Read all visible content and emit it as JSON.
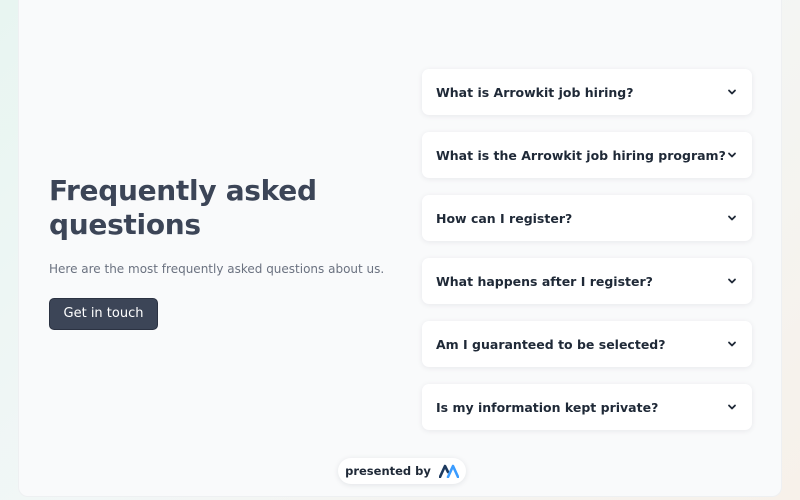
{
  "hero": {
    "title": "Frequently asked questions",
    "subtitle": "Here are the most frequently asked questions about us.",
    "cta_label": "Get in touch"
  },
  "faq": [
    {
      "question": "What is Arrowkit job hiring?"
    },
    {
      "question": "What is the Arrowkit job hiring program?"
    },
    {
      "question": "How can I register?"
    },
    {
      "question": "What happens after I register?"
    },
    {
      "question": "Am I guaranteed to be selected?"
    },
    {
      "question": "Is my information kept private?"
    }
  ],
  "footer": {
    "presented_by": "presented by",
    "logo_icon": "arrowkit-logo-icon"
  },
  "icons": {
    "expand": "chevron-down-icon"
  },
  "colors": {
    "primary": "#3c4557",
    "logo_dark": "#1e3a5f",
    "logo_light": "#3b9cff"
  }
}
